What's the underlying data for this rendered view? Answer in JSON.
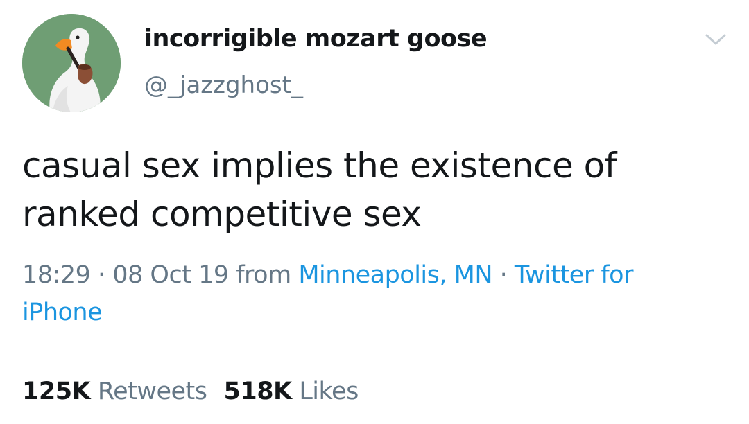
{
  "author": {
    "display_name": "incorrigible mozart goose",
    "handle": "@_jazzghost_"
  },
  "tweet": {
    "text": "casual sex implies the existence of ranked competitive sex"
  },
  "meta": {
    "time": "18:29",
    "separator1": " · ",
    "date": "08 Oct 19",
    "from_label": " from ",
    "location": "Minneapolis, MN",
    "separator2": " · ",
    "source": "Twitter for iPhone"
  },
  "stats": {
    "retweets_count": "125K",
    "retweets_label": "Retweets",
    "likes_count": "518K",
    "likes_label": "Likes"
  },
  "icons": {
    "avatar": "goose-with-pipe-avatar",
    "menu": "chevron-down-icon"
  },
  "colors": {
    "link": "#1b95e0",
    "secondary_text": "#657786",
    "avatar_background": "#6f9e74"
  }
}
